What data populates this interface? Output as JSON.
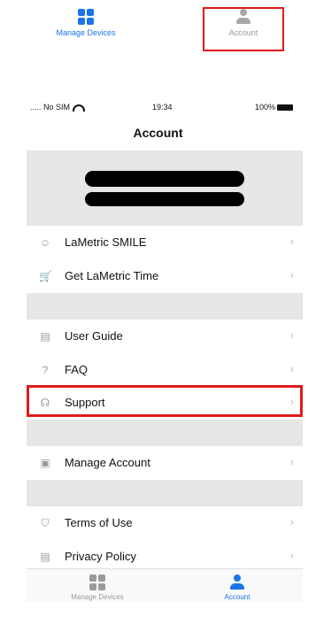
{
  "top_tabs": {
    "manage_label": "Manage Devices",
    "account_label": "Account"
  },
  "status_bar": {
    "carrier": "..... No SIM",
    "time": "19:34",
    "battery": "100%"
  },
  "nav": {
    "title": "Account"
  },
  "sections": {
    "products": [
      {
        "label": "LaMetric SMILE",
        "icon": "robot-face-icon"
      },
      {
        "label": "Get LaMetric Time",
        "icon": "cart-icon"
      }
    ],
    "help": [
      {
        "label": "User Guide",
        "icon": "document-icon"
      },
      {
        "label": "FAQ",
        "icon": "question-icon"
      },
      {
        "label": "Support",
        "icon": "headset-icon"
      }
    ],
    "account": [
      {
        "label": "Manage Account",
        "icon": "id-card-icon"
      }
    ],
    "legal": [
      {
        "label": "Terms of Use",
        "icon": "shield-icon"
      },
      {
        "label": "Privacy Policy",
        "icon": "list-doc-icon"
      }
    ]
  },
  "bottom_tabs": {
    "manage_label": "Manage Devices",
    "account_label": "Account"
  },
  "colors": {
    "accent": "#1a73e8",
    "highlight": "#e21a1a"
  }
}
